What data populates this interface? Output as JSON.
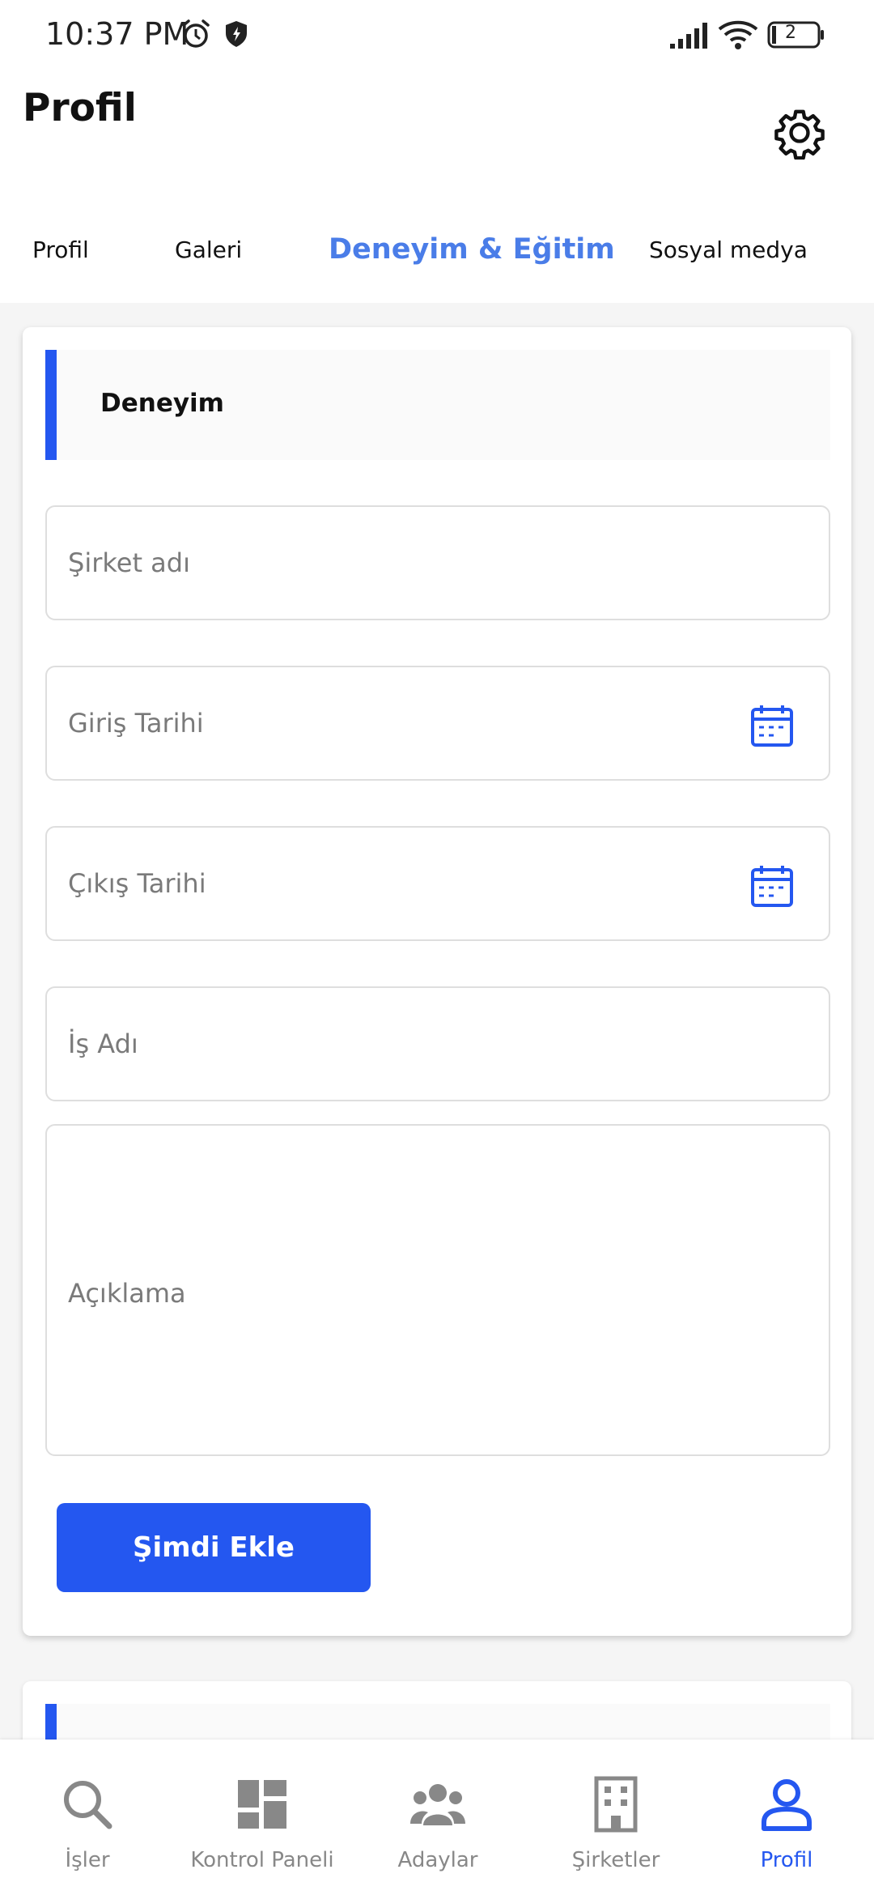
{
  "status": {
    "time": "10:37 PM",
    "battery": "2"
  },
  "header": {
    "title": "Profil"
  },
  "tabs": [
    {
      "label": "Profil"
    },
    {
      "label": "Galeri"
    },
    {
      "label": "Deneyim & Eğitim"
    },
    {
      "label": "Sosyal medya"
    }
  ],
  "form": {
    "section_title": "Deneyim",
    "company_placeholder": "Şirket adı",
    "start_date_placeholder": "Giriş Tarihi",
    "end_date_placeholder": "Çıkış Tarihi",
    "job_title_placeholder": "İş Adı",
    "description_placeholder": "Açıklama",
    "submit_label": "Şimdi Ekle"
  },
  "bottom_nav": [
    {
      "label": "İşler",
      "icon": "search-icon"
    },
    {
      "label": "Kontrol Paneli",
      "icon": "dashboard-icon"
    },
    {
      "label": "Adaylar",
      "icon": "people-icon"
    },
    {
      "label": "Şirketler",
      "icon": "building-icon"
    },
    {
      "label": "Profil",
      "icon": "person-icon"
    }
  ],
  "colors": {
    "accent": "#2457f0",
    "active_tab": "#4a7de8",
    "inactive_nav": "#888888"
  }
}
